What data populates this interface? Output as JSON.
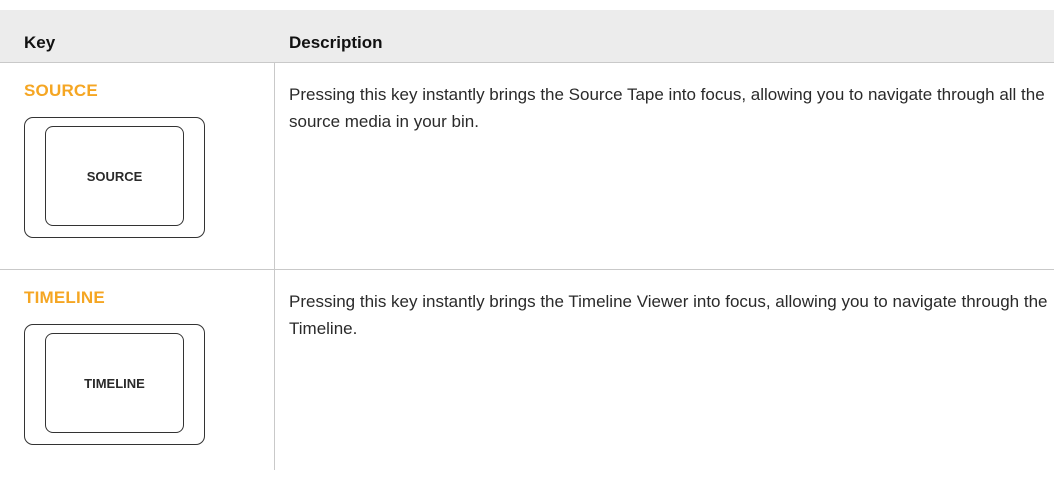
{
  "table": {
    "header": {
      "key": "Key",
      "description": "Description"
    },
    "rows": [
      {
        "key_title": "SOURCE",
        "keycap_label": "SOURCE",
        "description": "Pressing this key instantly brings the Source Tape into focus, allowing you to navigate through all the source media in your bin."
      },
      {
        "key_title": "TIMELINE",
        "keycap_label": "TIMELINE",
        "description": "Pressing this key instantly brings the Timeline Viewer into focus, allowing you to navigate through the Timeline."
      }
    ]
  },
  "colors": {
    "accent": "#f5a623",
    "header_bg": "#ececec",
    "border": "#c9c9c9"
  }
}
